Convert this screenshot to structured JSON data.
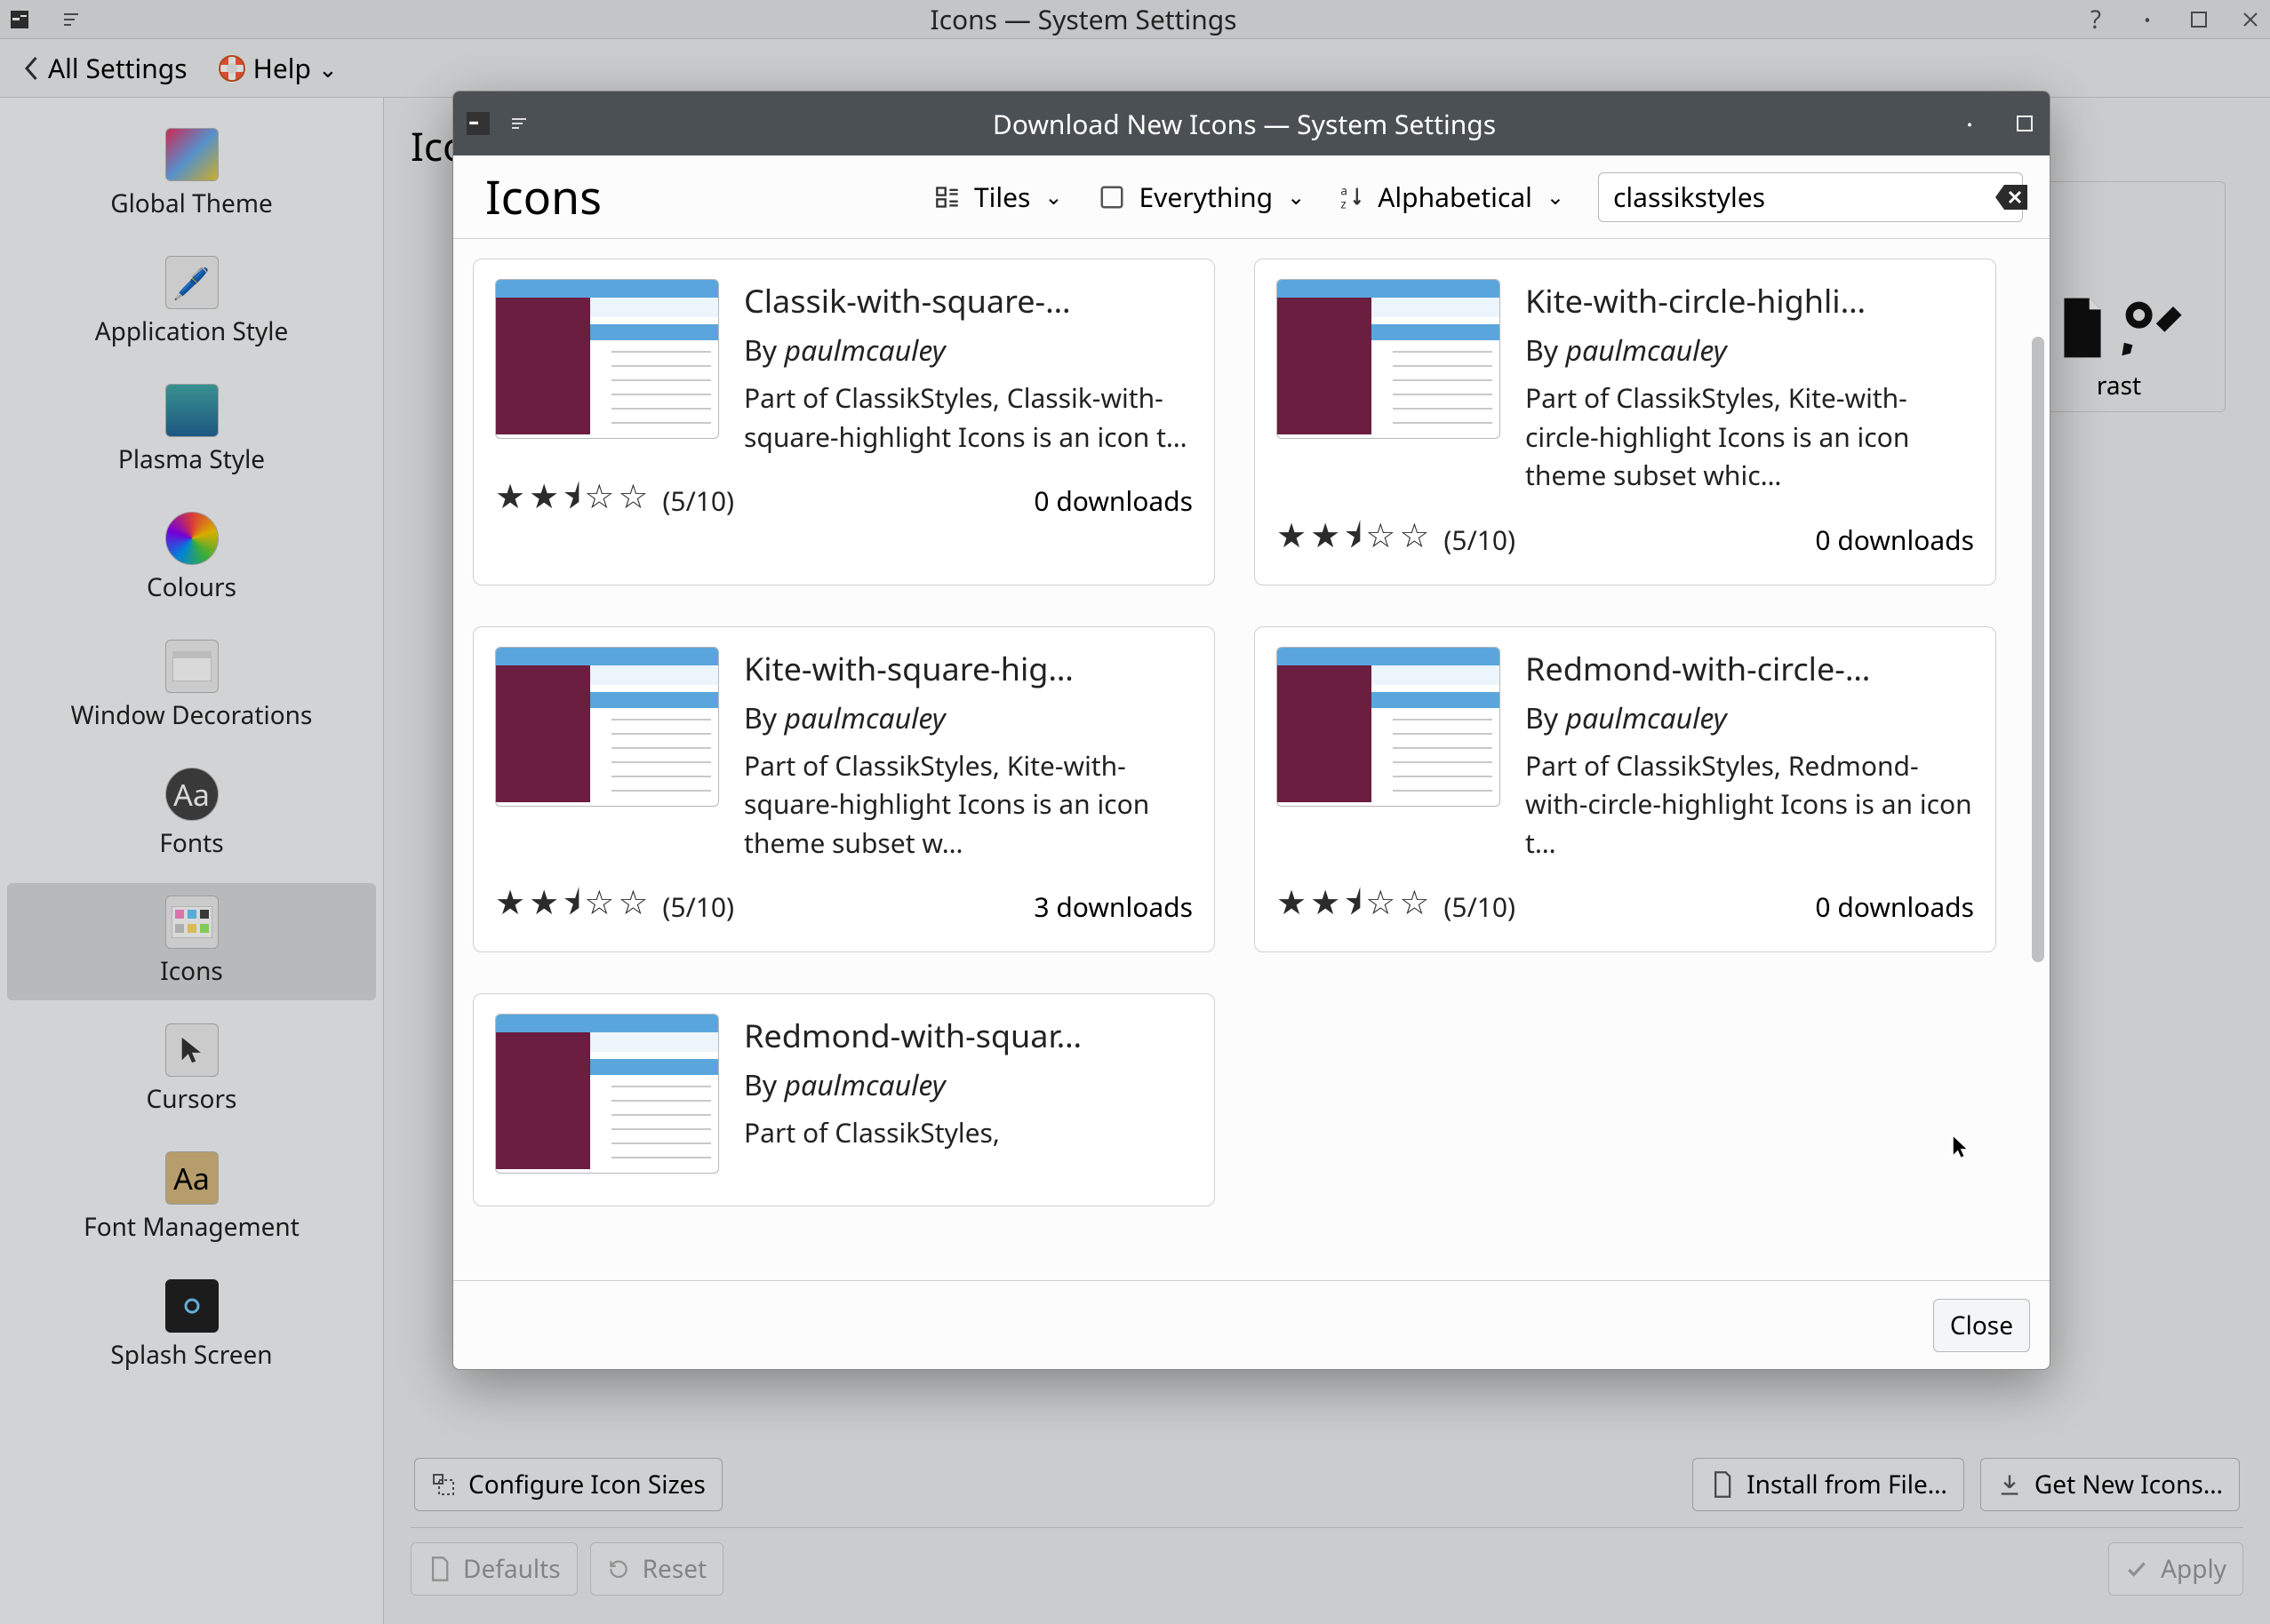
{
  "main_window": {
    "title": "Icons — System Settings"
  },
  "toolbar": {
    "back": "All Settings",
    "help": "Help"
  },
  "sidebar": {
    "items": [
      {
        "label": "Global Theme"
      },
      {
        "label": "Application Style"
      },
      {
        "label": "Plasma Style"
      },
      {
        "label": "Colours"
      },
      {
        "label": "Window Decorations"
      },
      {
        "label": "Fonts"
      },
      {
        "label": "Icons"
      },
      {
        "label": "Cursors"
      },
      {
        "label": "Font Management"
      },
      {
        "label": "Splash Screen"
      }
    ]
  },
  "main": {
    "heading": "Icons",
    "bg_tile_caption": "rast",
    "configure_sizes": "Configure Icon Sizes",
    "install_from_file": "Install from File…",
    "get_new": "Get New Icons…",
    "defaults": "Defaults",
    "reset": "Reset",
    "apply": "Apply"
  },
  "dialog": {
    "title": "Download New Icons — System Settings",
    "heading": "Icons",
    "view_mode": "Tiles",
    "filter": "Everything",
    "sort": "Alphabetical",
    "search_value": "classikstyles",
    "close": "Close"
  },
  "cards": [
    {
      "title": "Classik-with-square-…",
      "by": "By ",
      "author": "paulmcauley",
      "desc": "Part of ClassikStyles, Classik-with-square-highlight Icons is an icon t…",
      "stars": "★★⯨☆☆",
      "rating": "(5/10)",
      "downloads": "0 downloads"
    },
    {
      "title": "Kite-with-circle-highli…",
      "by": "By ",
      "author": "paulmcauley",
      "desc": "Part of ClassikStyles, Kite-with-circle-highlight Icons is an icon theme subset whic…",
      "stars": "★★⯨☆☆",
      "rating": "(5/10)",
      "downloads": "0 downloads"
    },
    {
      "title": "Kite-with-square-hig…",
      "by": "By ",
      "author": "paulmcauley",
      "desc": "Part of ClassikStyles, Kite-with-square-highlight Icons is an icon theme subset w…",
      "stars": "★★⯨☆☆",
      "rating": "(5/10)",
      "downloads": "3 downloads"
    },
    {
      "title": "Redmond-with-circle-…",
      "by": "By ",
      "author": "paulmcauley",
      "desc": "Part of ClassikStyles, Redmond-with-circle-highlight Icons is an icon t…",
      "stars": "★★⯨☆☆",
      "rating": "(5/10)",
      "downloads": "0 downloads"
    },
    {
      "title": "Redmond-with-squar…",
      "by": "By ",
      "author": "paulmcauley",
      "desc": "Part of ClassikStyles,",
      "stars": "",
      "rating": "",
      "downloads": ""
    }
  ]
}
